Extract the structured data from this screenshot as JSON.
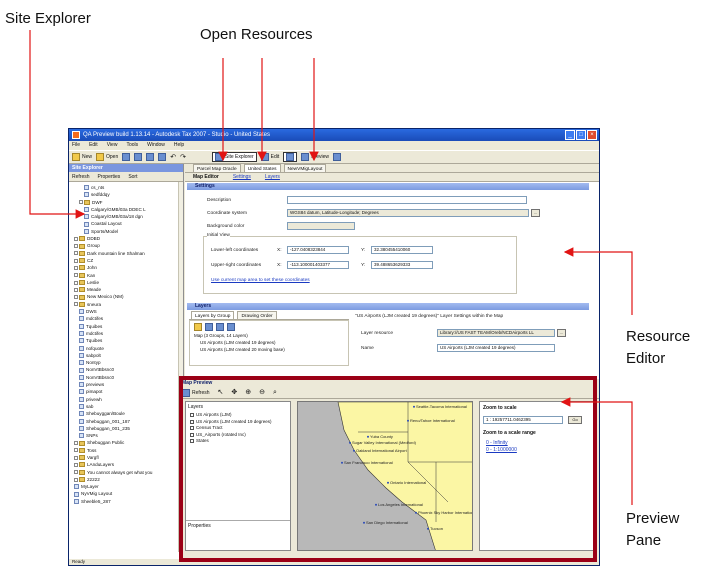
{
  "callouts": {
    "site_explorer": "Site Explorer",
    "open_resources": "Open Resources",
    "resource_editor_line1": "Resource",
    "resource_editor_line2": "Editor",
    "preview_pane_line1": "Preview",
    "preview_pane_line2": "Pane"
  },
  "window": {
    "title": "QA Preview build 1.13.14 - Autodesk Tax 2007 - Studio - United States",
    "menu": [
      "File",
      "Edit",
      "View",
      "Tools",
      "Window",
      "Help"
    ],
    "toolbar": [
      "New",
      "Open",
      "Site Explorer",
      "Edit",
      "Preview"
    ],
    "status": "Ready"
  },
  "site_explorer": {
    "title": "Site Explorer",
    "refresh": "Refresh",
    "properties": "Properties",
    "sort": "Sort",
    "items": [
      "cs_nts",
      "sedfddqy",
      "DWF",
      "Calgary/GMB/03a DDEC L",
      "Calgary/GMB/03a/18 dgn",
      "Coastal Layout",
      "Sports/Model",
      "DDBD",
      "Group",
      "Dark mountain line Shalman",
      "CZ",
      "John",
      "Kan",
      "Leslie",
      "Meade",
      "New Mexico (NM)",
      "sneura",
      "DWS",
      "mdctifes",
      "Tquibes",
      "mdctifes",
      "Tquibes",
      "nofquote",
      "sabpolt",
      "Nontyp",
      "NonVtBbsnc0",
      "NonVtBbsnc0",
      "previews",
      "pimapot",
      "privewh",
      "sab",
      "Shebuyggan/Boule",
      "Shebuggan_001_187",
      "Shebuggan_001_235",
      "SNPs",
      "Shebuggan Public",
      "Toss",
      "Vargfl",
      "LAnduLayers",
      "You cannot always get what you",
      "22222",
      "MyLayer",
      "NyVMig Layout",
      "Sheeble5_287"
    ]
  },
  "tabs": [
    "Parcel Map Oracle",
    "United States",
    "NewVMigLayout"
  ],
  "editor": {
    "title": "Map Editor",
    "links": [
      "Settings",
      "Layers"
    ],
    "settings_header": "Settings",
    "description_label": "Description",
    "description_value": "",
    "coordinate_label": "Coordinate system",
    "coordinate_value": "WGS84 datum, Latitude-Longitude; Degrees",
    "background_label": "Background color",
    "initial_view_label": "Initial View",
    "lower_left_label": "Lower-left coordinates",
    "upper_right_label": "Upper-right coordinates",
    "x_label": "X:",
    "y_label": "Y:",
    "lower_left_x": "-127.0408323844",
    "lower_left_y": "32.380455410060",
    "upper_right_x": "-113.100001403377",
    "upper_right_y": "39.488653629333",
    "compute_link": "Use current map area to set these coordinates",
    "layers_header": "Layers",
    "layer_tabs": [
      "Layers by Group",
      "Drawing Order"
    ],
    "layer_tree": [
      "Map (3 Groups, 14 Layers)",
      "US Airports (LJM created 19 degrees)",
      "US Airports (LJM created 20 moving base)"
    ],
    "layer_settings_title": "\"US Airports (LJM created 19 degrees)\" Layer Settings within the Map",
    "layer_resource_label": "Layer resource",
    "layer_resource_value": "Library://US FAST TEAM/Oreb/NCDAirports LL",
    "layer_name_label": "Name",
    "layer_name_value": "US Airports (LJM created 19 degrees)"
  },
  "preview": {
    "title": "Map Preview",
    "refresh": "Refresh",
    "layers_label": "Layers",
    "properties_label": "Properties",
    "layers": [
      "US Airports (LJM)",
      "US Airports (LJM created 19 degrees)",
      "Census Tract",
      "US_Airports (rotated Inc)",
      "States"
    ],
    "zoom_scale_label": "Zoom to scale",
    "zoom_scale_value": "1 : 19257711.0462395",
    "go": "Go",
    "zoom_range_label": "Zoom to a scale range",
    "ranges": [
      "0 - Infinity",
      "0 - 1:1000000"
    ],
    "map_labels": [
      "Reno/Tahoe International",
      "Yuba County",
      "Sugar Valley International (Medford)",
      "Oakland International Airport",
      "San Francisco International",
      "Ontario International",
      "Phoenix Sky Harbor International",
      "San Diego International",
      "Los Angeles International",
      "Tucson",
      "Seattle-Tacoma International"
    ]
  },
  "colors": {
    "accent": "#9b0016",
    "arrow": "#e11414",
    "map_land": "#fbf6a4",
    "map_sea": "#b8b8b8",
    "title_blue": "#2a6ae0"
  }
}
